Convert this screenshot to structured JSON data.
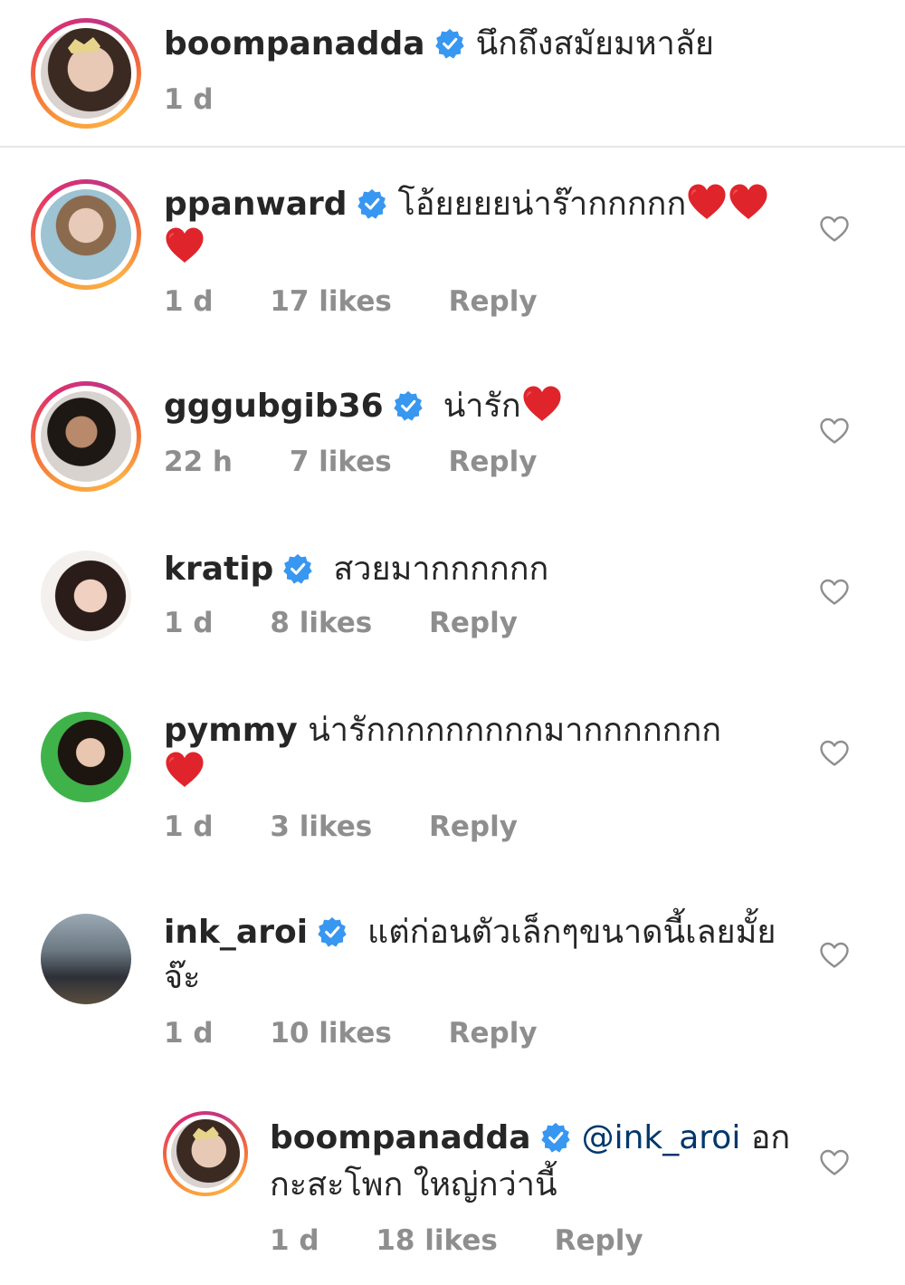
{
  "caption": {
    "username": "boompanadda",
    "text": "นึกถึงสมัยมหาลัย",
    "time": "1 d"
  },
  "comments": [
    {
      "username": "ppanward",
      "text_line1": "โอ้ยยยยน่าร๊ากกกกก",
      "text_line2": "",
      "time": "1 d",
      "likes": "17 likes",
      "reply": "Reply"
    },
    {
      "username": "gggubgib36",
      "text_line1": "น่ารัก",
      "time": "22 h",
      "likes": "7 likes",
      "reply": "Reply"
    },
    {
      "username": "kratip",
      "text_line1": "สวยมากกกกกก",
      "time": "1 d",
      "likes": "8 likes",
      "reply": "Reply"
    },
    {
      "username": "pymmy",
      "text_line1": "น่ารักกกกกกกกกมากกกกกกก",
      "time": "1 d",
      "likes": "3 likes",
      "reply": "Reply"
    },
    {
      "username": "ink_aroi",
      "text_line1": "แต่ก่อนตัวเล็กๆขนาดนี้เลยมั้ย",
      "text_line2": "จ๊ะ",
      "time": "1 d",
      "likes": "10 likes",
      "reply": "Reply"
    },
    {
      "username": "boompanadda",
      "mention": "@ink_aroi",
      "text_line1": " อก",
      "text_line2": "กะสะโพก ใหญ่กว่านี้",
      "time": "1 d",
      "likes": "18 likes",
      "reply": "Reply"
    }
  ],
  "colors": {
    "verified_blue": "#3897f0",
    "heart_red": "#e0242b",
    "meta_gray": "#8e8e8e",
    "mention_blue": "#00376b"
  },
  "icons": {
    "verified": "verified-badge-icon",
    "like": "heart-outline-icon",
    "emoji": "red-heart-emoji"
  }
}
